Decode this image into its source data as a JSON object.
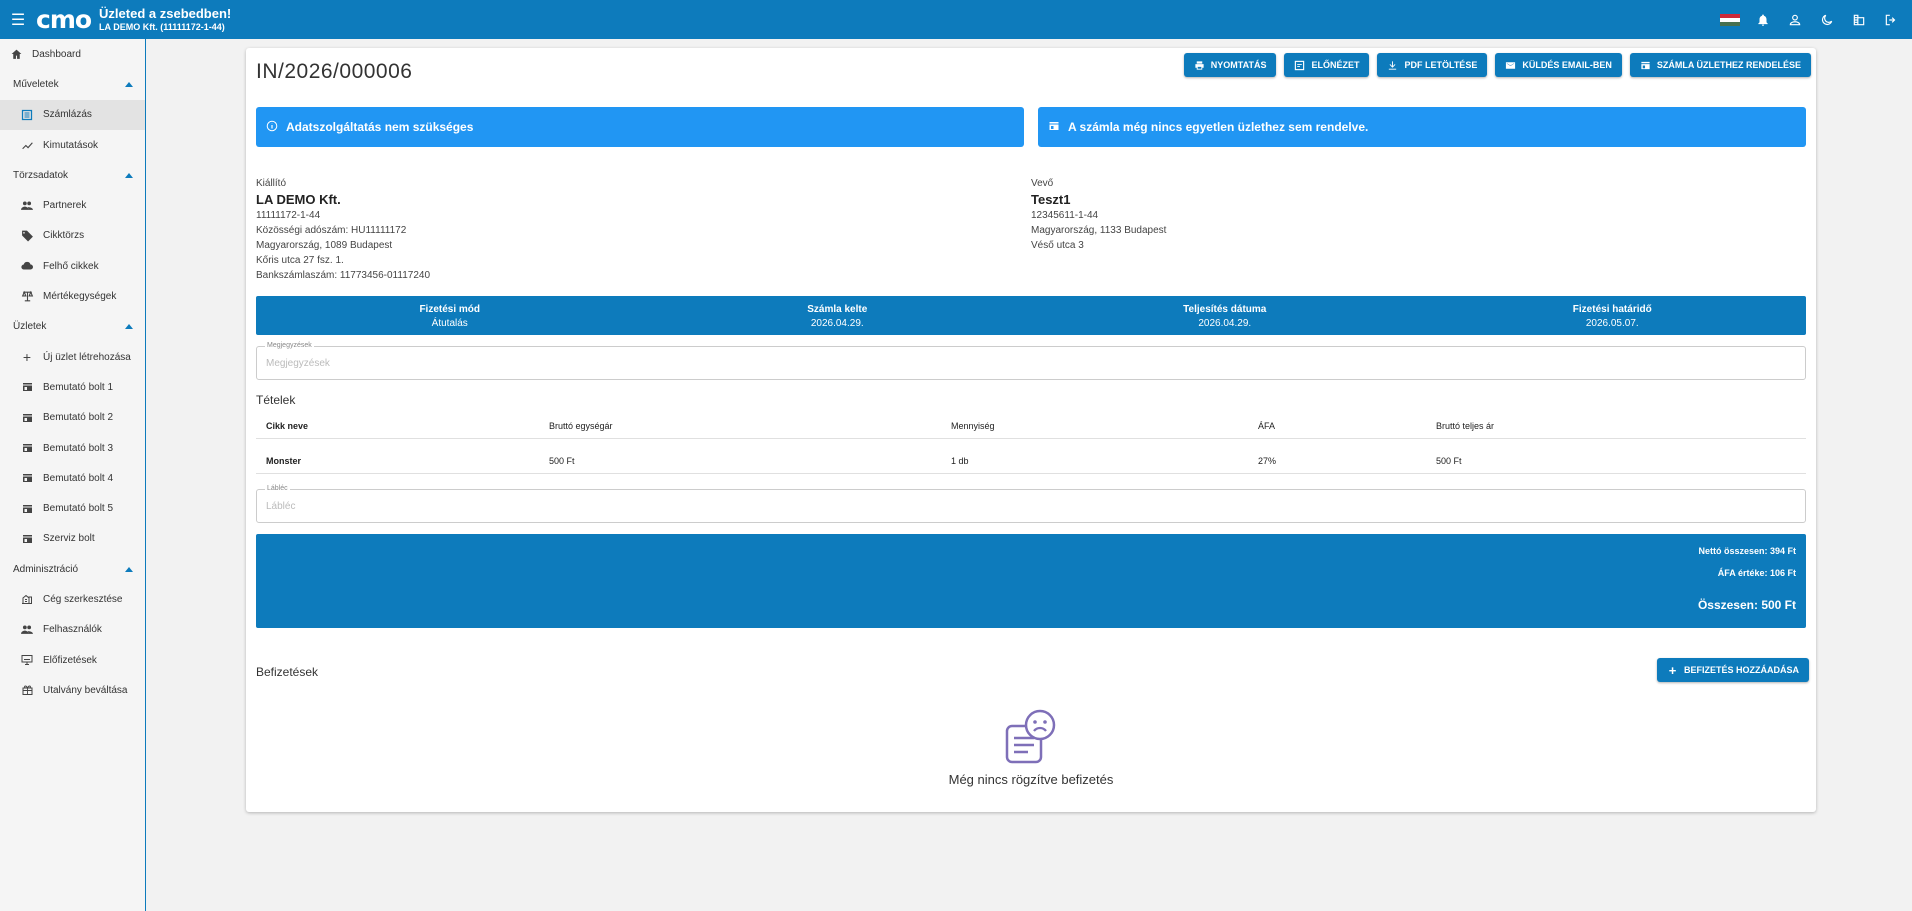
{
  "header": {
    "logo": "cmo",
    "title": "Üzleted a zsebedben!",
    "subtitle": "LA DEMO Kft. (11111172-1-44)"
  },
  "sidebar": {
    "dashboard": "Dashboard",
    "groups": {
      "muveletek": "Műveletek",
      "torzsadatok": "Törzsadatok",
      "uzletek": "Üzletek",
      "adminisztracio": "Adminisztráció"
    },
    "items": {
      "szamlazas": "Számlázás",
      "kimutatasok": "Kimutatások",
      "partnerek": "Partnerek",
      "cikktorzs": "Cikktörzs",
      "felho_cikkek": "Felhő cikkek",
      "mertekegysegek": "Mértékegységek",
      "uj_uzlet": "Új üzlet létrehozása",
      "bolt1": "Bemutató bolt 1",
      "bolt2": "Bemutató bolt 2",
      "bolt3": "Bemutató bolt 3",
      "bolt4": "Bemutató bolt 4",
      "bolt5": "Bemutató bolt 5",
      "szerviz": "Szerviz bolt",
      "ceg": "Cég szerkesztése",
      "felhasznalok": "Felhasználók",
      "elofizetesek": "Előfizetések",
      "utalvany": "Utalvány beváltása"
    }
  },
  "invoice": {
    "number": "IN/2026/000006",
    "actions": {
      "print": "NYOMTATÁS",
      "preview": "ELŐNÉZET",
      "pdf": "PDF LETÖLTÉSE",
      "email": "KÜLDÉS EMAIL-BEN",
      "assign": "SZÁMLA ÜZLETHEZ RENDELÉSE"
    },
    "alerts": {
      "data_service": "Adatszolgáltatás nem szükséges",
      "not_assigned": "A számla még nincs egyetlen üzlethez sem rendelve."
    },
    "issuer": {
      "label": "Kiállító",
      "name": "LA DEMO Kft.",
      "tax": "11111172-1-44",
      "eu_tax": "Közösségi adószám: HU11111172",
      "city": "Magyarország, 1089 Budapest",
      "street": "Kőris utca 27 fsz. 1.",
      "bank": "Bankszámlaszám: 11773456-01117240"
    },
    "buyer": {
      "label": "Vevő",
      "name": "Teszt1",
      "tax": "12345611-1-44",
      "city": "Magyarország, 1133 Budapest",
      "street": "Véső utca 3"
    },
    "info": {
      "payment_label": "Fizetési mód",
      "payment_value": "Átutalás",
      "date_label": "Számla kelte",
      "date_value": "2026.04.29.",
      "completion_label": "Teljesítés dátuma",
      "completion_value": "2026.04.29.",
      "due_label": "Fizetési határidő",
      "due_value": "2026.05.07."
    },
    "notes": {
      "label": "Megjegyzések",
      "placeholder": "Megjegyzések"
    },
    "items_title": "Tételek",
    "columns": {
      "name": "Cikk neve",
      "unit_price": "Bruttó egységár",
      "qty": "Mennyiség",
      "vat": "ÁFA",
      "total": "Bruttó teljes ár"
    },
    "rows": [
      {
        "name": "Monster",
        "unit_price": "500 Ft",
        "qty": "1 db",
        "vat": "27%",
        "total": "500 Ft"
      }
    ],
    "footer": {
      "label": "Lábléc",
      "placeholder": "Lábléc"
    },
    "totals": {
      "net": "Nettó összesen: 394 Ft",
      "vat": "ÁFA értéke: 106 Ft",
      "gross": "Összesen: 500 Ft"
    },
    "payments_title": "Befizetések",
    "add_payment": "BEFIZETÉS HOZZÁADÁSA",
    "no_payments": "Még nincs rögzítve befizetés"
  },
  "colors": {
    "primary": "#0d7bbc",
    "alert": "#2196f3"
  }
}
